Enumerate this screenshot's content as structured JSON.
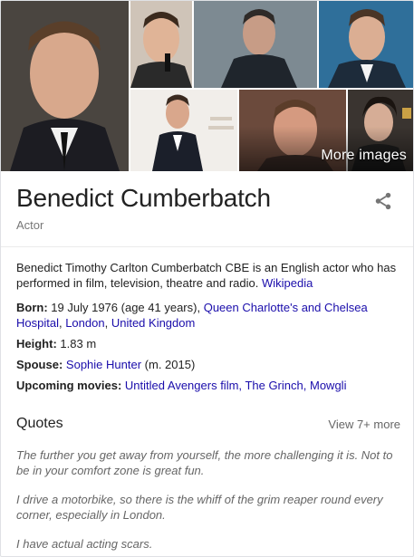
{
  "mosaic": {
    "more_images_label": "More images"
  },
  "header": {
    "title": "Benedict Cumberbatch",
    "subtitle": "Actor"
  },
  "description": {
    "text": "Benedict Timothy Carlton Cumberbatch CBE is an English actor who has performed in film, television, theatre and radio.",
    "source_link": "Wikipedia"
  },
  "facts": {
    "born": {
      "label": "Born:",
      "value": "19 July 1976 (age 41 years),",
      "links": [
        "Queen Charlotte's and Chelsea Hospital",
        "London",
        "United Kingdom"
      ]
    },
    "height": {
      "label": "Height:",
      "value": "1.83 m"
    },
    "spouse": {
      "label": "Spouse:",
      "link": "Sophie Hunter",
      "suffix": "(m. 2015)"
    },
    "upcoming_movies": {
      "label": "Upcoming movies:",
      "links": [
        "Untitled Avengers film",
        "The Grinch",
        "Mowgli"
      ]
    }
  },
  "quotes": {
    "title": "Quotes",
    "more_label": "View 7+ more",
    "items": [
      "The further you get away from yourself, the more challenging it is. Not to be in your comfort zone is great fun.",
      "I drive a motorbike, so there is the whiff of the grim reaper round every corner, especially in London.",
      "I have actual acting scars."
    ]
  },
  "colors": {
    "link": "#1a0dab",
    "text": "#222222",
    "secondary_text": "#777777",
    "divider": "#ebebeb"
  },
  "icons": {
    "share": "share-icon"
  }
}
